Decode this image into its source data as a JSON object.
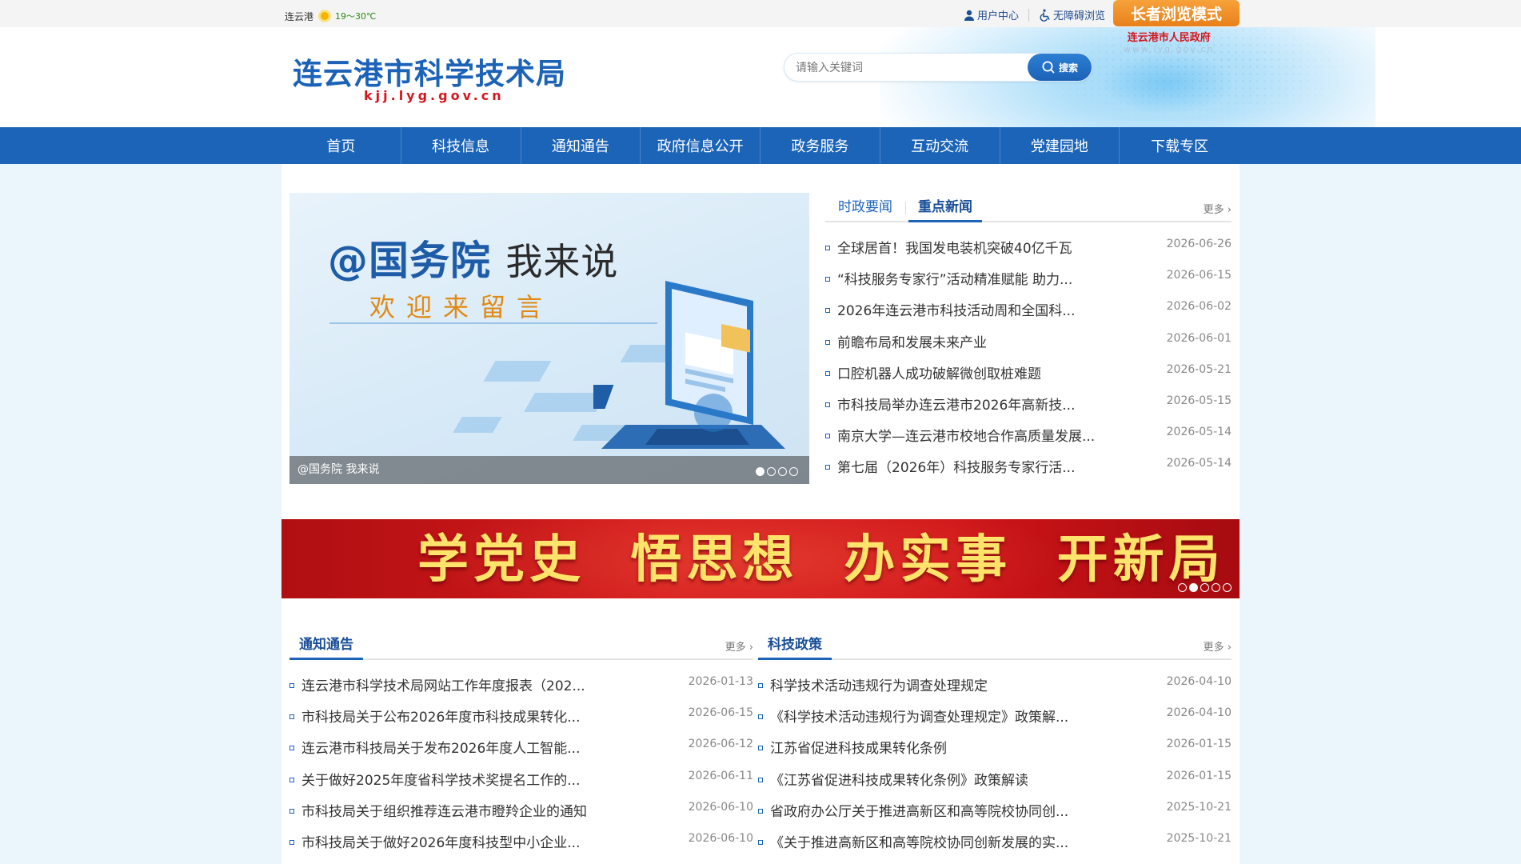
{
  "topbar": {
    "city": "连云港",
    "temp": "19～30℃",
    "user_center": "用户中心",
    "accessible": "无障碍浏览",
    "elder_mode": "长者浏览模式",
    "icons": [
      "weather-sun-icon",
      "user-icon",
      "accessibility-icon"
    ]
  },
  "header": {
    "title": "连云港市科学技术局",
    "url": "kjj.lyg.gov.cn",
    "search_placeholder": "请输入关键词",
    "search_button": "搜索",
    "gov_name": "连云港市人民政府",
    "gov_url": "www.lyg.gov.cn"
  },
  "nav": [
    "首页",
    "科技信息",
    "通知通告",
    "政府信息公开",
    "政务服务",
    "互动交流",
    "党建园地",
    "下载专区"
  ],
  "slider": {
    "headline_a": "@国务院",
    "headline_b": "我来说",
    "subline": "欢迎来留言",
    "caption": "@国务院 我来说",
    "slide_count": 4,
    "active_slide": 1
  },
  "news": {
    "tabs": [
      "时政要闻",
      "重点新闻"
    ],
    "active_tab": 1,
    "more": "更多",
    "items": [
      {
        "title": "全球居首！我国发电装机突破40亿千瓦",
        "date": "2026-06-26"
      },
      {
        "title": "“科技服务专家行”活动精准赋能 助力...",
        "date": "2026-06-15"
      },
      {
        "title": "2026年连云港市科技活动周和全国科...",
        "date": "2026-06-02"
      },
      {
        "title": "前瞻布局和发展未来产业",
        "date": "2026-06-01"
      },
      {
        "title": "口腔机器人成功破解微创取桩难题",
        "date": "2026-05-21"
      },
      {
        "title": "市科技局举办连云港市2026年高新技...",
        "date": "2026-05-15"
      },
      {
        "title": "南京大学—连云港市校地合作高质量发展...",
        "date": "2026-05-14"
      },
      {
        "title": "第七届（2026年）科技服务专家行活...",
        "date": "2026-05-14"
      }
    ]
  },
  "banner": {
    "text": "学党史  悟思想  办实事  开新局",
    "slide_count": 5,
    "active_slide": 2
  },
  "notices": {
    "title": "通知通告",
    "more": "更多",
    "items": [
      {
        "title": "连云港市科学技术局网站工作年度报表（202...",
        "date": "2026-01-13"
      },
      {
        "title": "市科技局关于公布2026年度市科技成果转化...",
        "date": "2026-06-15"
      },
      {
        "title": "连云港市科技局关于发布2026年度人工智能...",
        "date": "2026-06-12"
      },
      {
        "title": "关于做好2025年度省科学技术奖提名工作的...",
        "date": "2026-06-11"
      },
      {
        "title": "市科技局关于组织推荐连云港市瞪羚企业的通知",
        "date": "2026-06-10"
      },
      {
        "title": "市科技局关于做好2026年度科技型中小企业...",
        "date": "2026-06-10"
      }
    ]
  },
  "policies": {
    "title": "科技政策",
    "more": "更多",
    "items": [
      {
        "title": "科学技术活动违规行为调查处理规定",
        "date": "2026-04-10"
      },
      {
        "title": "《科学技术活动违规行为调查处理规定》政策解...",
        "date": "2026-04-10"
      },
      {
        "title": "江苏省促进科技成果转化条例",
        "date": "2026-01-15"
      },
      {
        "title": "《江苏省促进科技成果转化条例》政策解读",
        "date": "2026-01-15"
      },
      {
        "title": "省政府办公厅关于推进高新区和高等院校协同创...",
        "date": "2025-10-21"
      },
      {
        "title": "《关于推进高新区和高等院校协同创新发展的实...",
        "date": "2025-10-21"
      }
    ]
  },
  "colors": {
    "primary": "#1b64b8",
    "accent_orange": "#f29530",
    "banner_red": "#cf1519",
    "banner_text": "#ffe36a"
  }
}
